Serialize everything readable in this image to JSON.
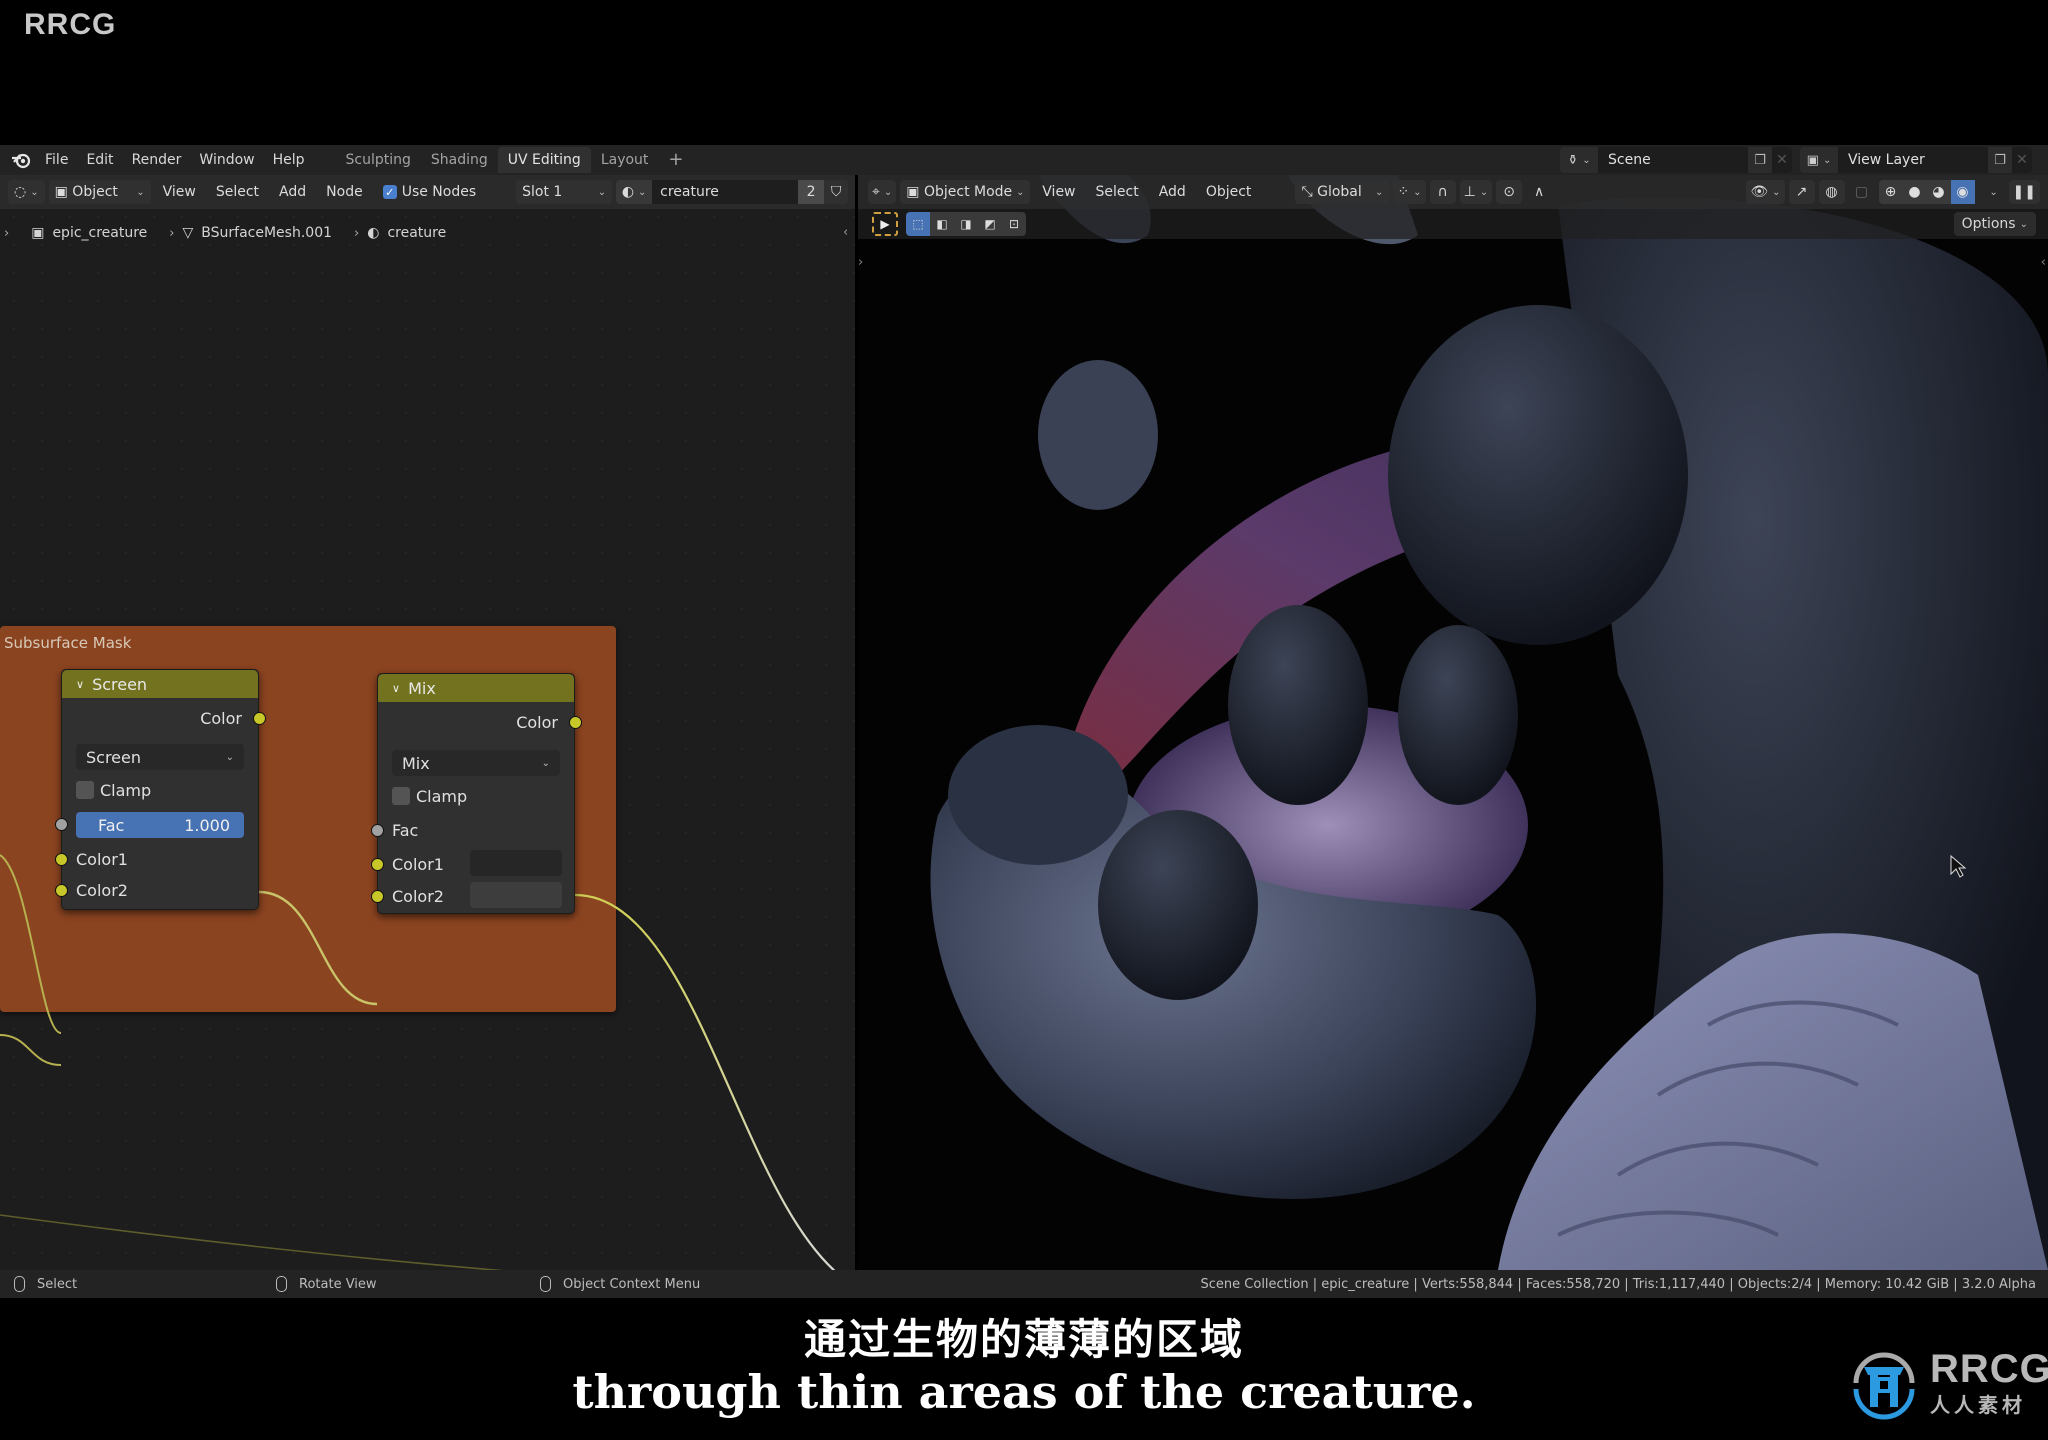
{
  "watermark": {
    "top_left": "RRCG"
  },
  "topbar": {
    "logo": "blender-logo-icon",
    "menus": [
      "File",
      "Edit",
      "Render",
      "Window",
      "Help"
    ],
    "workspaces": [
      {
        "label": "Sculpting",
        "active": false
      },
      {
        "label": "Shading",
        "active": false
      },
      {
        "label": "UV Editing",
        "active": true
      },
      {
        "label": "Layout",
        "active": false
      }
    ],
    "add_workspace": "+",
    "scene": {
      "icon": "scene-icon",
      "value": "Scene"
    },
    "view_layer": {
      "icon": "view-layer-icon",
      "value": "View Layer"
    }
  },
  "node_editor": {
    "header": {
      "editor_type_icon": "shader-editor-icon",
      "object_select": "Object",
      "menus": [
        "View",
        "Select",
        "Add",
        "Node"
      ],
      "use_nodes": {
        "label": "Use Nodes",
        "checked": true
      },
      "slot": "Slot 1",
      "material_name": "creature",
      "user_count": "2"
    },
    "breadcrumb": [
      "epic_creature",
      "BSurfaceMesh.001",
      "creature"
    ],
    "frame": {
      "label": "Subsurface Mask",
      "color": "#8b4420"
    },
    "nodes": {
      "screen": {
        "title": "Screen",
        "output": "Color",
        "blend_mode": "Screen",
        "clamp_label": "Clamp",
        "clamp": false,
        "fac_label": "Fac",
        "fac_value": "1.000",
        "inputs": [
          "Color1",
          "Color2"
        ]
      },
      "mix": {
        "title": "Mix",
        "output": "Color",
        "blend_mode": "Mix",
        "clamp_label": "Clamp",
        "clamp": false,
        "inputs": [
          "Fac",
          "Color1",
          "Color2"
        ]
      }
    },
    "colors": {
      "node_header": "#72721f",
      "socket_color": "#c7c729",
      "socket_float": "#a1a1a1",
      "accent": "#4772b3"
    }
  },
  "viewport": {
    "header": {
      "editor_type_icon": "3d-viewport-icon",
      "mode": "Object Mode",
      "menus": [
        "View",
        "Select",
        "Add",
        "Object"
      ],
      "orientation": "Global",
      "options_label": "Options"
    },
    "shading_modes": [
      "wireframe",
      "solid",
      "material-preview",
      "rendered"
    ],
    "active_shading": "rendered"
  },
  "statusbar": {
    "left": [
      {
        "icon": "mouse-left-icon",
        "label": "Select"
      },
      {
        "icon": "mouse-middle-icon",
        "label": "Rotate View"
      },
      {
        "icon": "mouse-right-icon",
        "label": "Object Context Menu"
      }
    ],
    "stats": "Scene Collection | epic_creature | Verts:558,844 | Faces:558,720 | Tris:1,117,440 | Objects:2/4 | Memory: 10.42 GiB | 3.2.0 Alpha"
  },
  "subtitles": {
    "zh": "通过生物的薄薄的区域",
    "en": "through thin areas of the creature."
  },
  "brand": {
    "name": "RRCG",
    "tagline": "人人素材"
  }
}
